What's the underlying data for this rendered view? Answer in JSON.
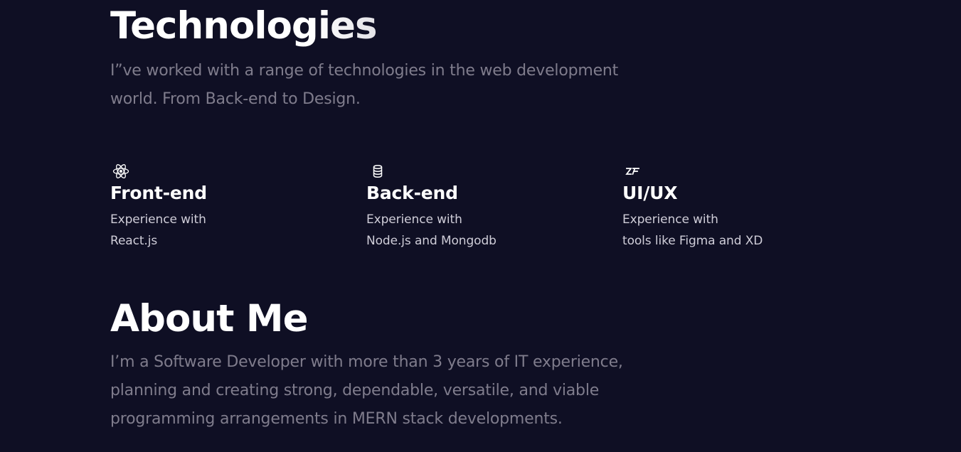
{
  "technologies": {
    "heading": "Technologies",
    "description": "I”ve worked with a range of technologies in the web development world. From Back-end to Design."
  },
  "cards": [
    {
      "icon": "react-icon",
      "title": "Front-end",
      "line1": "Experience with",
      "line2": "React.js"
    },
    {
      "icon": "database-icon",
      "title": "Back-end",
      "line1": "Experience with",
      "line2": "Node.js and Mongodb"
    },
    {
      "icon": "zeplin-icon",
      "title": "UI/UX",
      "line1": "Experience with",
      "line2": "tools like Figma and XD"
    }
  ],
  "about": {
    "heading": "About Me",
    "description": "I’m a Software Developer with more than 3 years of IT experience, planning and creating strong, dependable, versatile, and viable programming arrangements in MERN stack developments."
  },
  "colors": {
    "background": "#0f0f24",
    "heading": "#ffffff",
    "muted_text": "#7f7c8c",
    "card_text": "#cfcdd8"
  }
}
